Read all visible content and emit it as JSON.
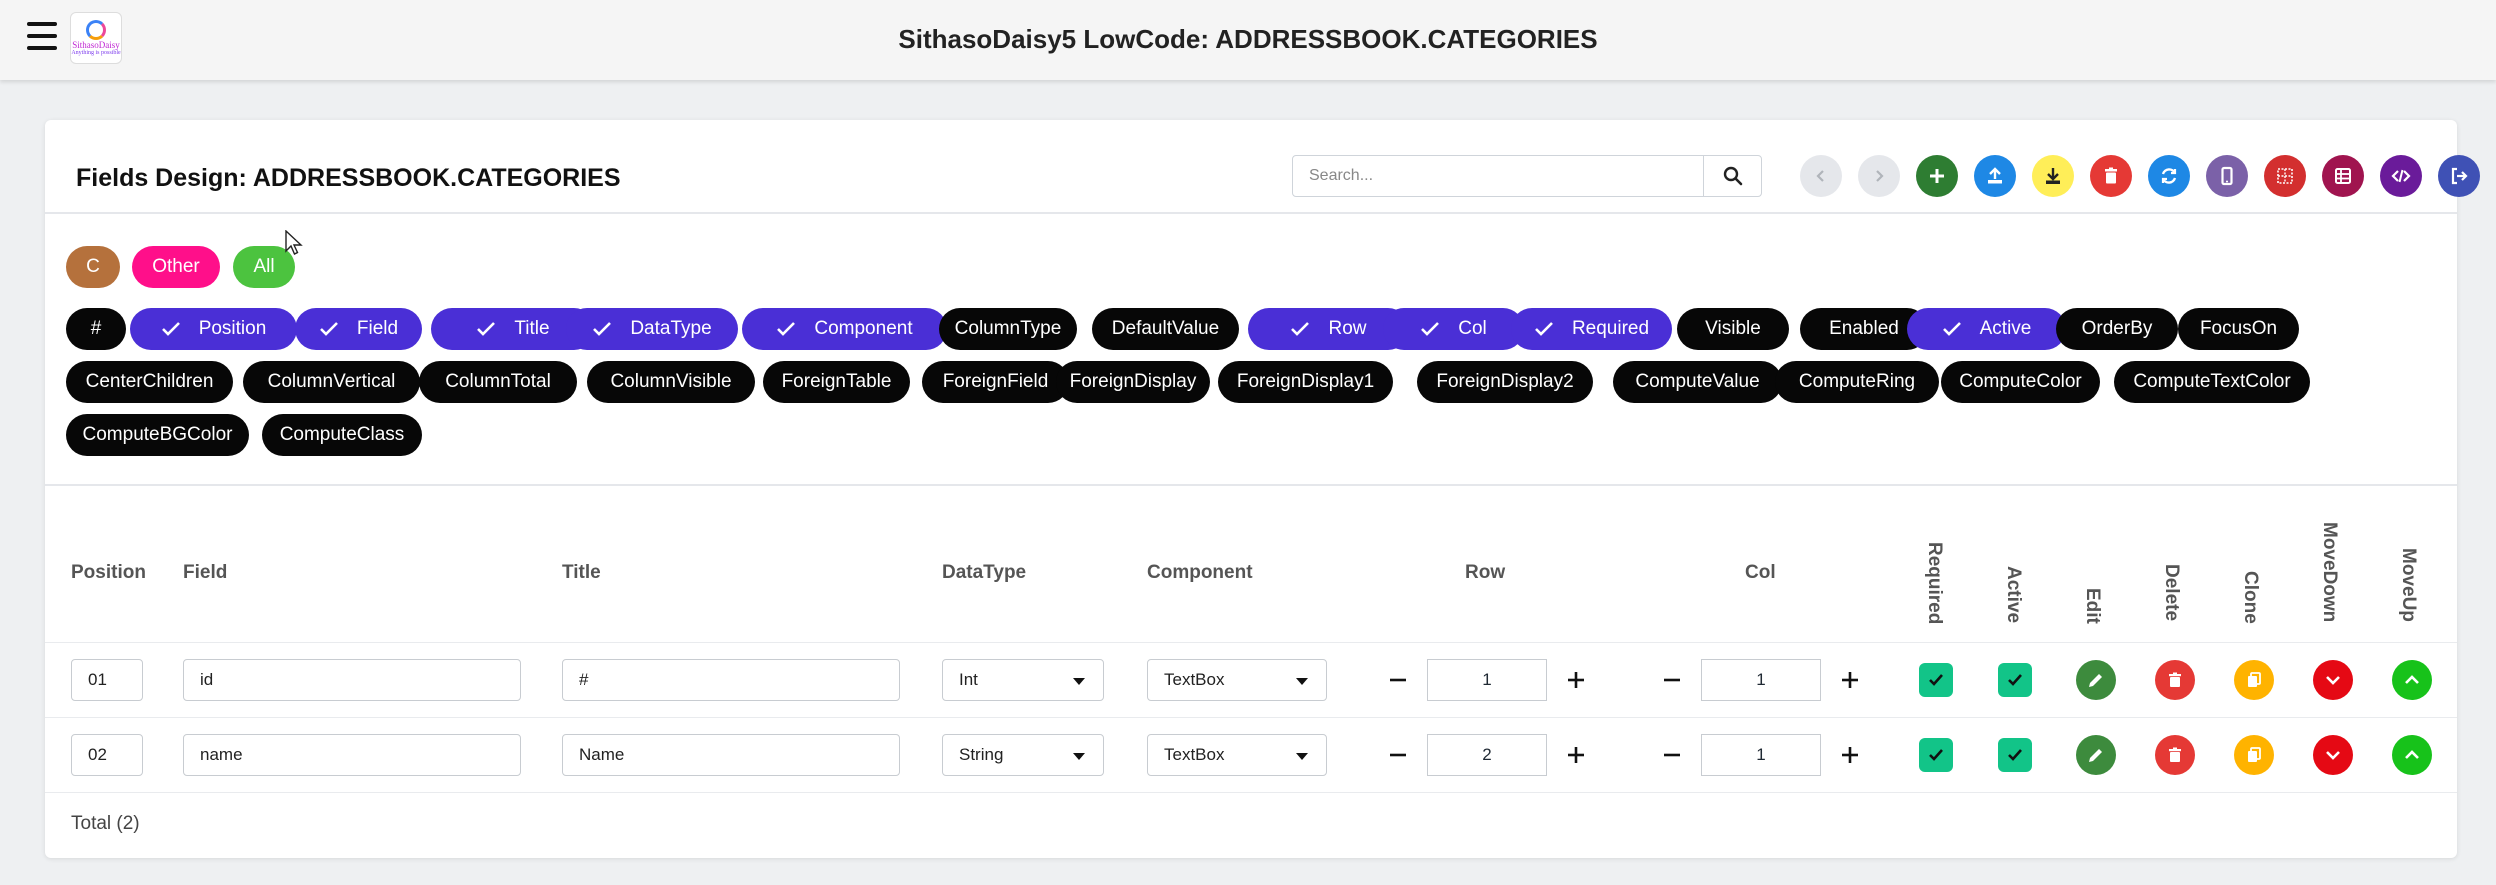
{
  "header": {
    "title": "SithasoDaisy5 LowCode: ADDRESSBOOK.CATEGORIES",
    "logo_text": "SithasoDaisy",
    "logo_tagline": "Anything is possible"
  },
  "card": {
    "title": "Fields Design: ADDRESSBOOK.CATEGORIES"
  },
  "search": {
    "placeholder": "Search...",
    "value": ""
  },
  "toolbar": [
    {
      "name": "back-icon",
      "color": "#e5e7eb",
      "enabled": false
    },
    {
      "name": "forward-icon",
      "color": "#e5e7eb",
      "enabled": false
    },
    {
      "name": "add-icon",
      "color": "#2e7d32",
      "enabled": true
    },
    {
      "name": "upload-icon",
      "color": "#1e88e5",
      "enabled": true
    },
    {
      "name": "download-icon",
      "color": "#ffee58",
      "enabled": true
    },
    {
      "name": "delete-icon",
      "color": "#e53935",
      "enabled": true
    },
    {
      "name": "refresh-icon",
      "color": "#1e88e5",
      "enabled": true
    },
    {
      "name": "mobile-icon",
      "color": "#7b61a8",
      "enabled": true
    },
    {
      "name": "grid-icon",
      "color": "#d32f2f",
      "enabled": true
    },
    {
      "name": "table-icon",
      "color": "#a0144f",
      "enabled": true
    },
    {
      "name": "code-icon",
      "color": "#6a1b9a",
      "enabled": true
    },
    {
      "name": "logout-icon",
      "color": "#3f51b5",
      "enabled": true
    }
  ],
  "filters": [
    {
      "label": "C",
      "color": "#b5713c"
    },
    {
      "label": "Other",
      "color": "#ff0f8a"
    },
    {
      "label": "All",
      "color": "#4cc33f"
    }
  ],
  "column_chips": [
    {
      "label": "#",
      "checked": false
    },
    {
      "label": "Position",
      "checked": true
    },
    {
      "label": "Field",
      "checked": true
    },
    {
      "label": "Title",
      "checked": true
    },
    {
      "label": "DataType",
      "checked": true
    },
    {
      "label": "Component",
      "checked": true
    },
    {
      "label": "ColumnType",
      "checked": false
    },
    {
      "label": "DefaultValue",
      "checked": false
    },
    {
      "label": "Row",
      "checked": true
    },
    {
      "label": "Col",
      "checked": true
    },
    {
      "label": "Required",
      "checked": true
    },
    {
      "label": "Visible",
      "checked": false
    },
    {
      "label": "Enabled",
      "checked": false
    },
    {
      "label": "Active",
      "checked": true
    },
    {
      "label": "OrderBy",
      "checked": false
    },
    {
      "label": "FocusOn",
      "checked": false
    },
    {
      "label": "CenterChildren",
      "checked": false
    },
    {
      "label": "ColumnVertical",
      "checked": false
    },
    {
      "label": "ColumnTotal",
      "checked": false
    },
    {
      "label": "ColumnVisible",
      "checked": false
    },
    {
      "label": "ForeignTable",
      "checked": false
    },
    {
      "label": "ForeignField",
      "checked": false
    },
    {
      "label": "ForeignDisplay",
      "checked": false
    },
    {
      "label": "ForeignDisplay1",
      "checked": false
    },
    {
      "label": "ForeignDisplay2",
      "checked": false
    },
    {
      "label": "ComputeValue",
      "checked": false
    },
    {
      "label": "ComputeRing",
      "checked": false
    },
    {
      "label": "ComputeColor",
      "checked": false
    },
    {
      "label": "ComputeTextColor",
      "checked": false
    },
    {
      "label": "ComputeBGColor",
      "checked": false
    },
    {
      "label": "ComputeClass",
      "checked": false
    }
  ],
  "table": {
    "headers": [
      "Position",
      "Field",
      "Title",
      "DataType",
      "Component",
      "Row",
      "Col"
    ],
    "rotated_headers": [
      "Required",
      "Active",
      "Edit",
      "Delete",
      "Clone",
      "MoveDown",
      "MoveUp"
    ],
    "rows": [
      {
        "position": "01",
        "field": "id",
        "title": "#",
        "datatype": "Int",
        "component": "TextBox",
        "row": "1",
        "col": "1",
        "required": true,
        "active": true
      },
      {
        "position": "02",
        "field": "name",
        "title": "Name",
        "datatype": "String",
        "component": "TextBox",
        "row": "2",
        "col": "1",
        "required": true,
        "active": true
      }
    ],
    "total": "Total (2)"
  },
  "action_colors": {
    "edit": "#3d8b3d",
    "delete": "#e53935",
    "clone": "#ffb300",
    "move_down": "#e50914",
    "move_up": "#17c21a"
  }
}
